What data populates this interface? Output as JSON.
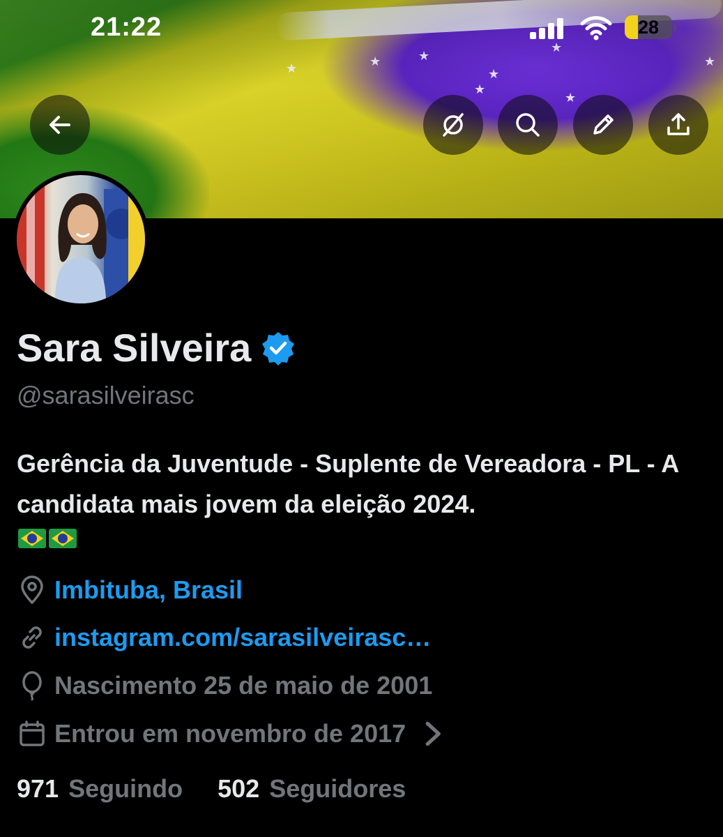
{
  "status_bar": {
    "time": "21:22",
    "battery_level": "28",
    "battery_fraction": 0.28,
    "battery_color": "#f2d21b",
    "icons": [
      "cellular-signal-icon",
      "wifi-icon",
      "battery-icon"
    ]
  },
  "header": {
    "buttons": [
      {
        "name": "back-button",
        "icon": "arrow-left-icon"
      },
      {
        "name": "grok-button",
        "icon": "slashed-circle-icon"
      },
      {
        "name": "search-button",
        "icon": "search-icon"
      },
      {
        "name": "edit-button",
        "icon": "pencil-icon"
      },
      {
        "name": "share-button",
        "icon": "share-upload-icon"
      }
    ]
  },
  "profile": {
    "name": "Sara Silveira",
    "handle": "@sarasilveirasc",
    "verified_color": "#1d9bf0",
    "bio": "Gerência da Juventude - Suplente de Vereadora - PL - A candidata mais jovem da eleição 2024.",
    "bio_emojis": [
      "brazil-flag-emoji",
      "brazil-flag-emoji"
    ],
    "location": "Imbituba, Brasil",
    "website": "instagram.com/sarasilveirasc…",
    "birth": "Nascimento 25 de maio de 2001",
    "joined": "Entrou em novembro de 2017",
    "following_count": "971",
    "following_label": "Seguindo",
    "followers_count": "502",
    "followers_label": "Seguidores"
  },
  "colors": {
    "background": "#000000",
    "text_primary": "#e7e9ea",
    "text_secondary": "#71767b",
    "link": "#1d9bf0"
  }
}
